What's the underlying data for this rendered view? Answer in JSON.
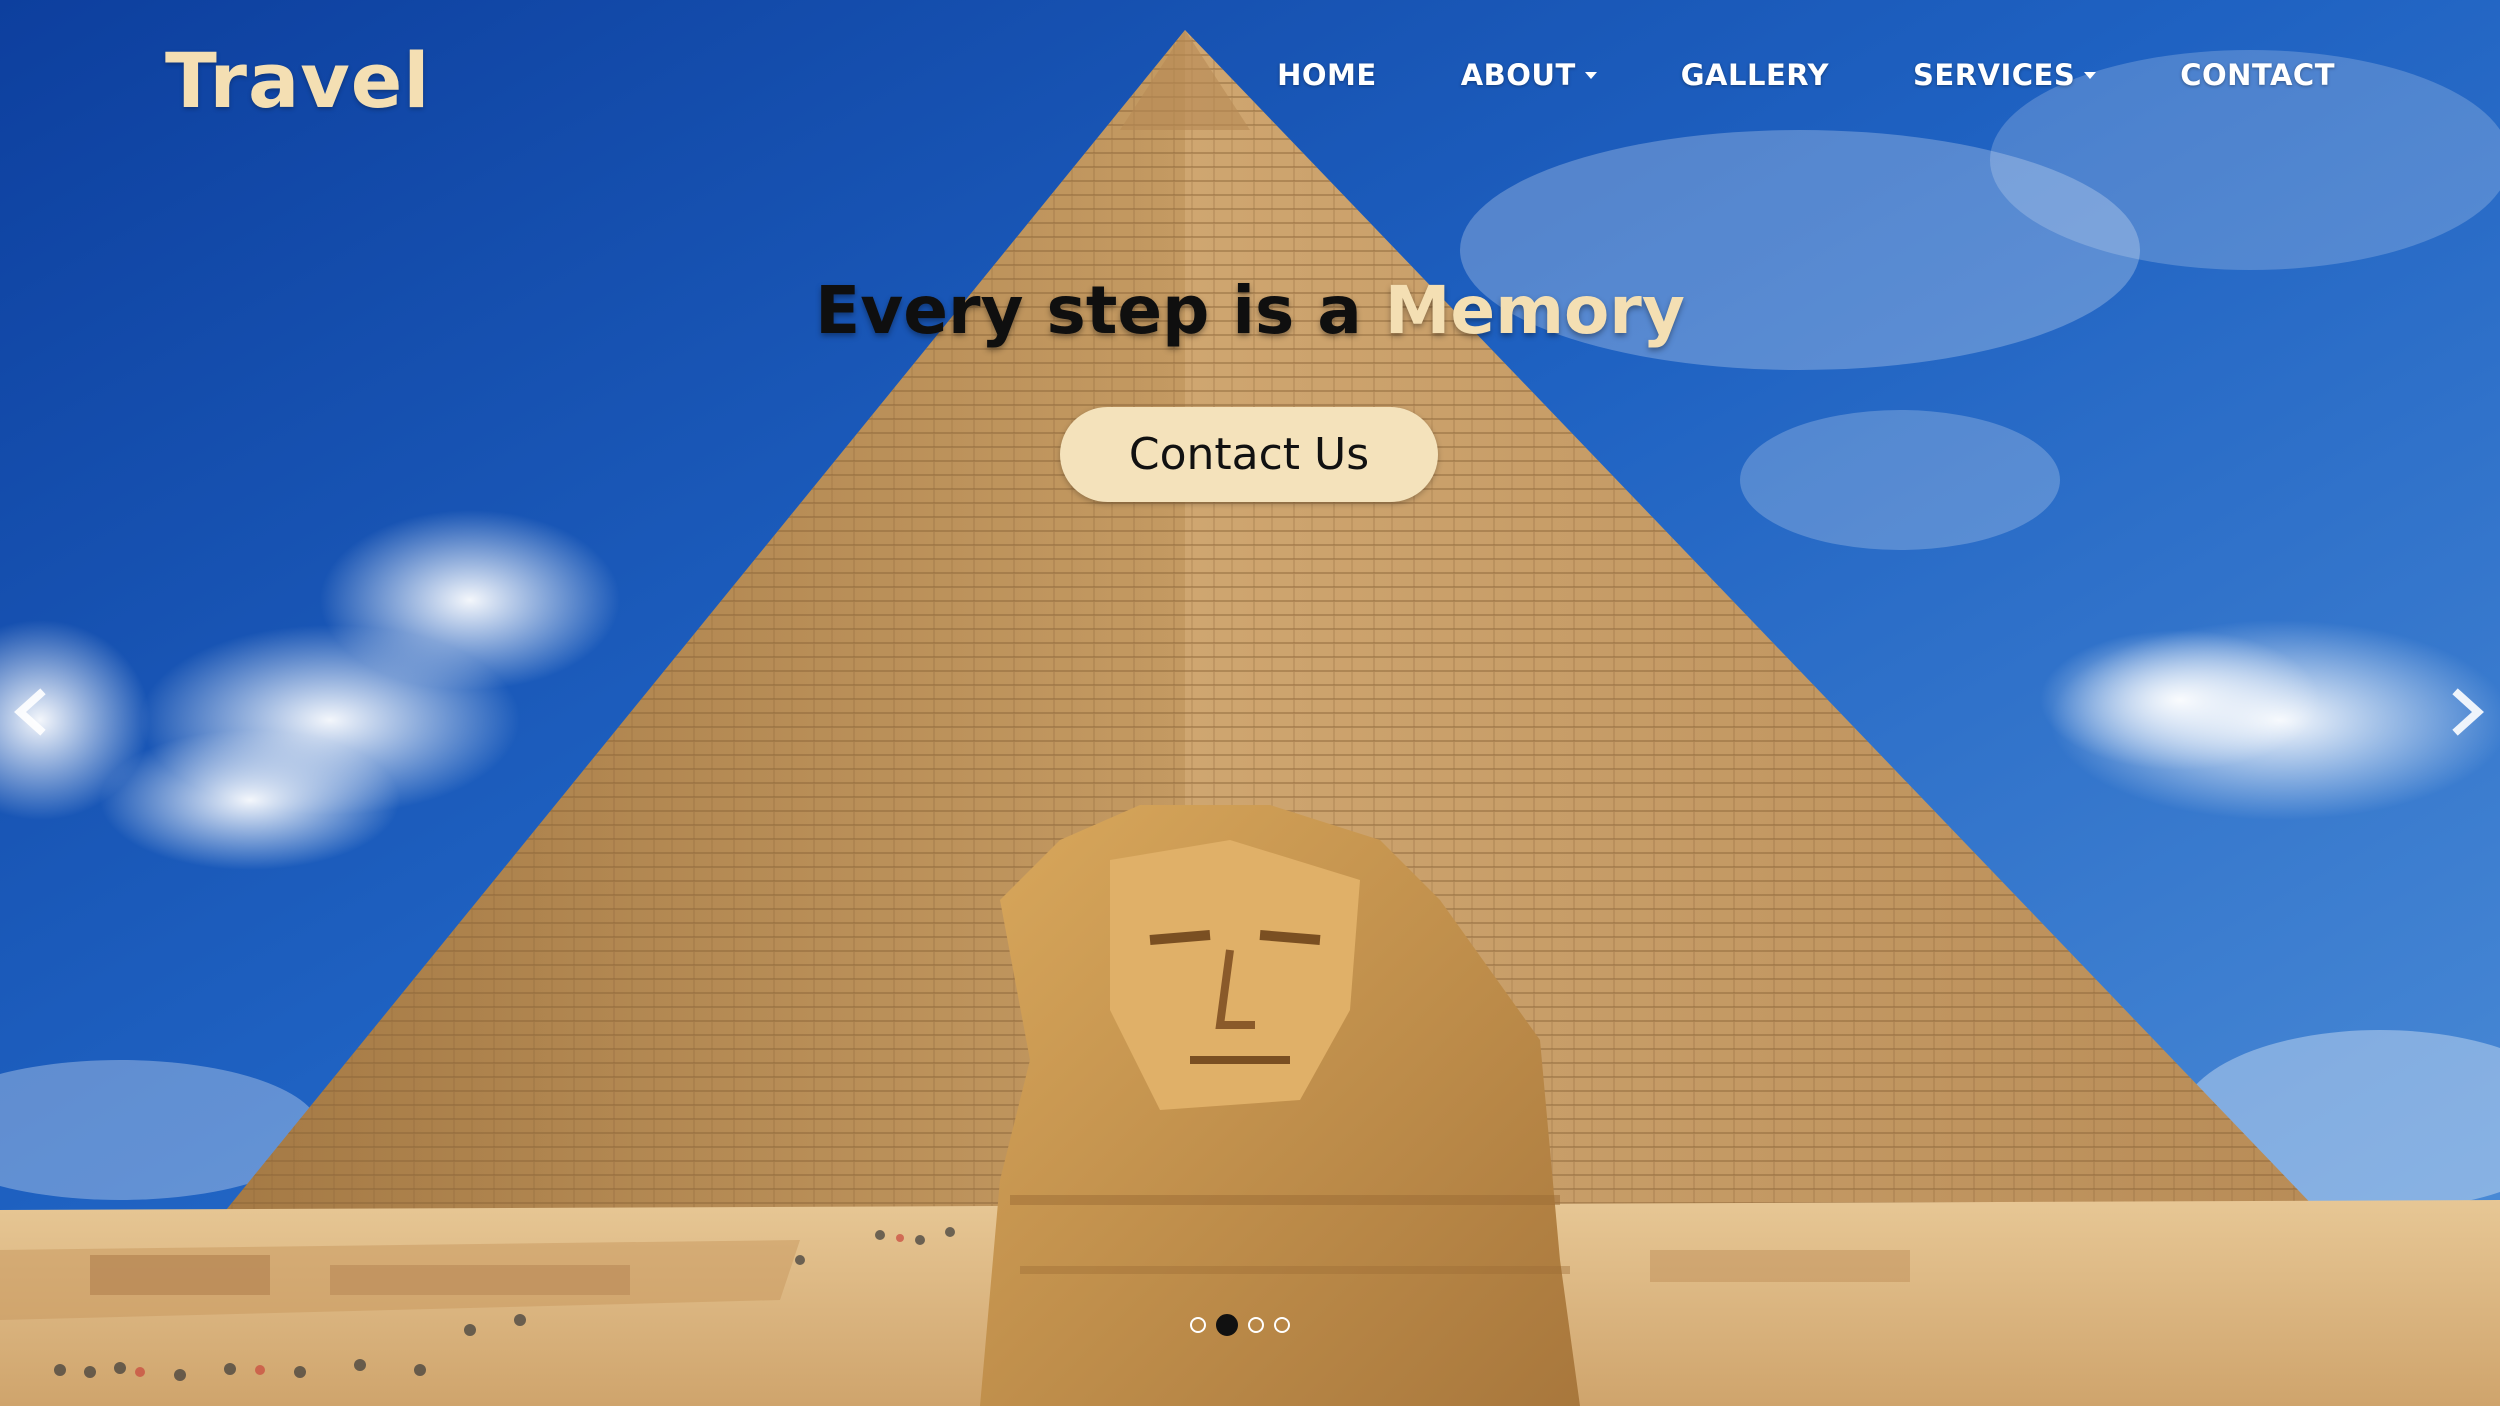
{
  "brand": {
    "logo_text": "Travel"
  },
  "nav": {
    "items": [
      {
        "label": "HOME",
        "has_dropdown": false
      },
      {
        "label": "ABOUT",
        "has_dropdown": true
      },
      {
        "label": "GALLERY",
        "has_dropdown": false
      },
      {
        "label": "SERVICES",
        "has_dropdown": true
      },
      {
        "label": "CONTACT",
        "has_dropdown": false
      }
    ]
  },
  "hero": {
    "heading_main": "Every step is a ",
    "heading_accent": "Memory",
    "cta_label": "Contact Us",
    "image": "great pyramid of giza and sphinx under blue sky with clouds"
  },
  "carousel": {
    "prev_icon": "chevron-left-icon",
    "next_icon": "chevron-right-icon",
    "slide_count": 4,
    "active_slide": 2
  },
  "colors": {
    "accent": "#f4dfb3",
    "button_bg": "#f4e2bb",
    "nav_text": "#ffffff",
    "heading_text": "#0f0f0f"
  }
}
